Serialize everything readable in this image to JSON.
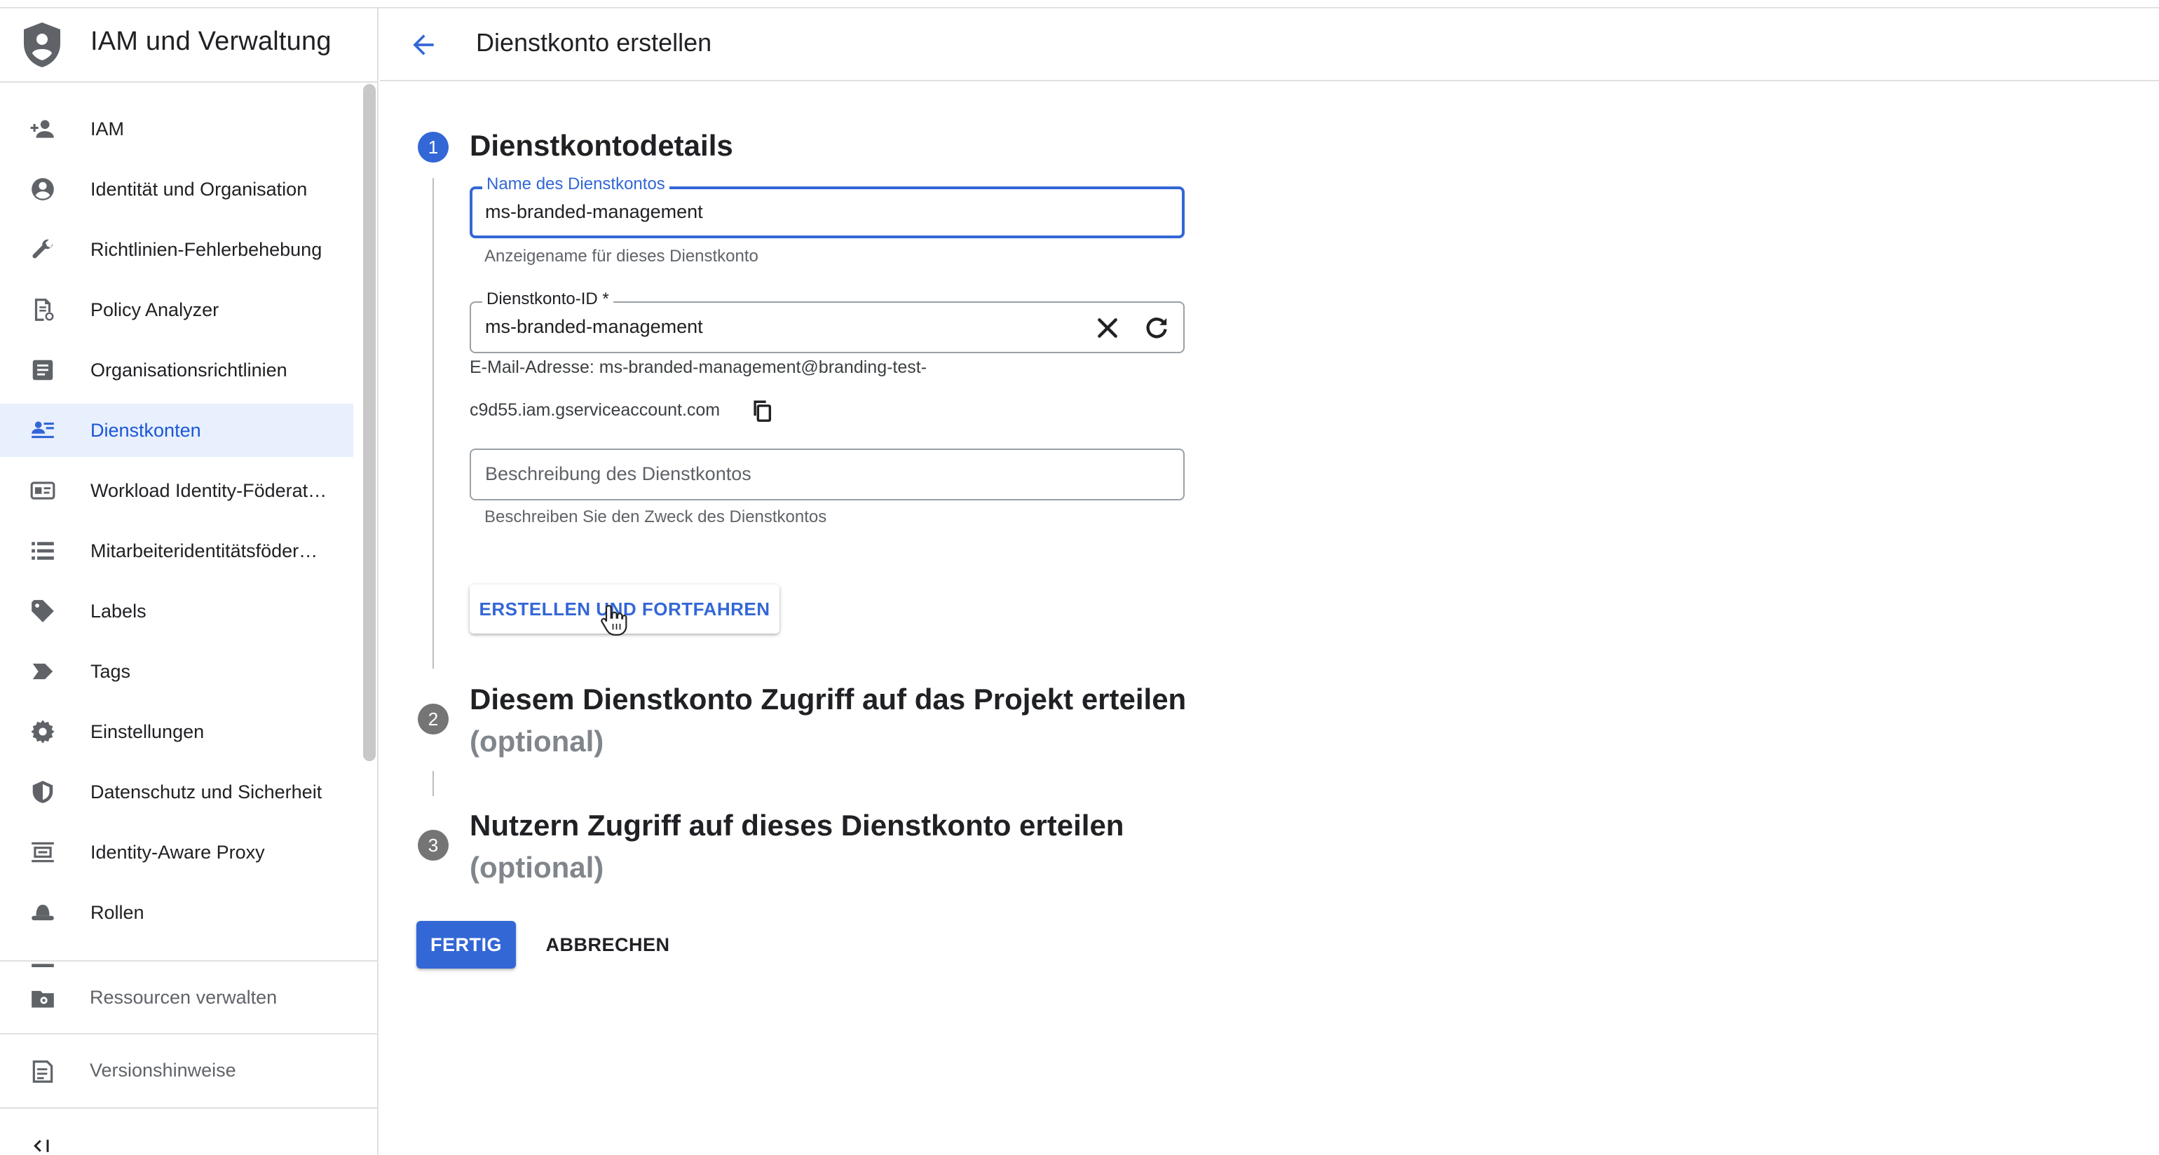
{
  "app": {
    "title": "IAM und Verwaltung"
  },
  "sidebar": {
    "items": [
      {
        "label": "IAM",
        "icon": "person-add-icon"
      },
      {
        "label": "Identität und Organisation",
        "icon": "account-circle-icon"
      },
      {
        "label": "Richtlinien-Fehlerbehebung",
        "icon": "wrench-icon"
      },
      {
        "label": "Policy Analyzer",
        "icon": "policy-document-icon"
      },
      {
        "label": "Organisationsrichtlinien",
        "icon": "article-icon"
      },
      {
        "label": "Dienstkonten",
        "icon": "service-account-icon",
        "active": true
      },
      {
        "label": "Workload Identity-Föderat…",
        "icon": "badge-card-icon"
      },
      {
        "label": "Mitarbeiteridentitätsföder…",
        "icon": "list-icon"
      },
      {
        "label": "Labels",
        "icon": "tag-icon"
      },
      {
        "label": "Tags",
        "icon": "label-arrow-icon"
      },
      {
        "label": "Einstellungen",
        "icon": "gear-icon"
      },
      {
        "label": "Datenschutz und Sicherheit",
        "icon": "shield-icon"
      },
      {
        "label": "Identity-Aware Proxy",
        "icon": "proxy-icon"
      },
      {
        "label": "Rollen",
        "icon": "hat-icon"
      }
    ],
    "bottom": [
      {
        "label": "Ressourcen verwalten",
        "icon": "folder-gear-icon"
      },
      {
        "label": "Versionshinweise",
        "icon": "notes-icon"
      }
    ],
    "collapse_icon": "collapse-sidebar-icon"
  },
  "header": {
    "title": "Dienstkonto erstellen",
    "back_icon": "arrow-back-icon"
  },
  "steps": [
    {
      "number": "1",
      "title": "Dienstkontodetails",
      "optional": ""
    },
    {
      "number": "2",
      "title": "Diesem Dienstkonto Zugriff auf das Projekt erteilen",
      "optional": "(optional)"
    },
    {
      "number": "3",
      "title": "Nutzern Zugriff auf dieses Dienstkonto erteilen",
      "optional": "(optional)"
    }
  ],
  "form": {
    "name": {
      "label": "Name des Dienstkontos",
      "value": "ms-branded-management",
      "hint": "Anzeigename für dieses Dienstkonto"
    },
    "id": {
      "label": "Dienstkonto-ID *",
      "value": "ms-branded-management"
    },
    "email_line1": "E-Mail-Adresse: ms-branded-management@branding-test-",
    "email_line2": "c9d55.iam.gserviceaccount.com",
    "description": {
      "placeholder": "Beschreibung des Dienstkontos",
      "hint": "Beschreiben Sie den Zweck des Dienstkontos"
    },
    "create_continue_label": "ERSTELLEN UND FORTFAHREN"
  },
  "actions": {
    "done_label": "FERTIG",
    "cancel_label": "ABBRECHEN"
  },
  "colors": {
    "accent": "#3367d6",
    "active_bg": "#e8f0fe",
    "step_inactive": "#757575"
  }
}
